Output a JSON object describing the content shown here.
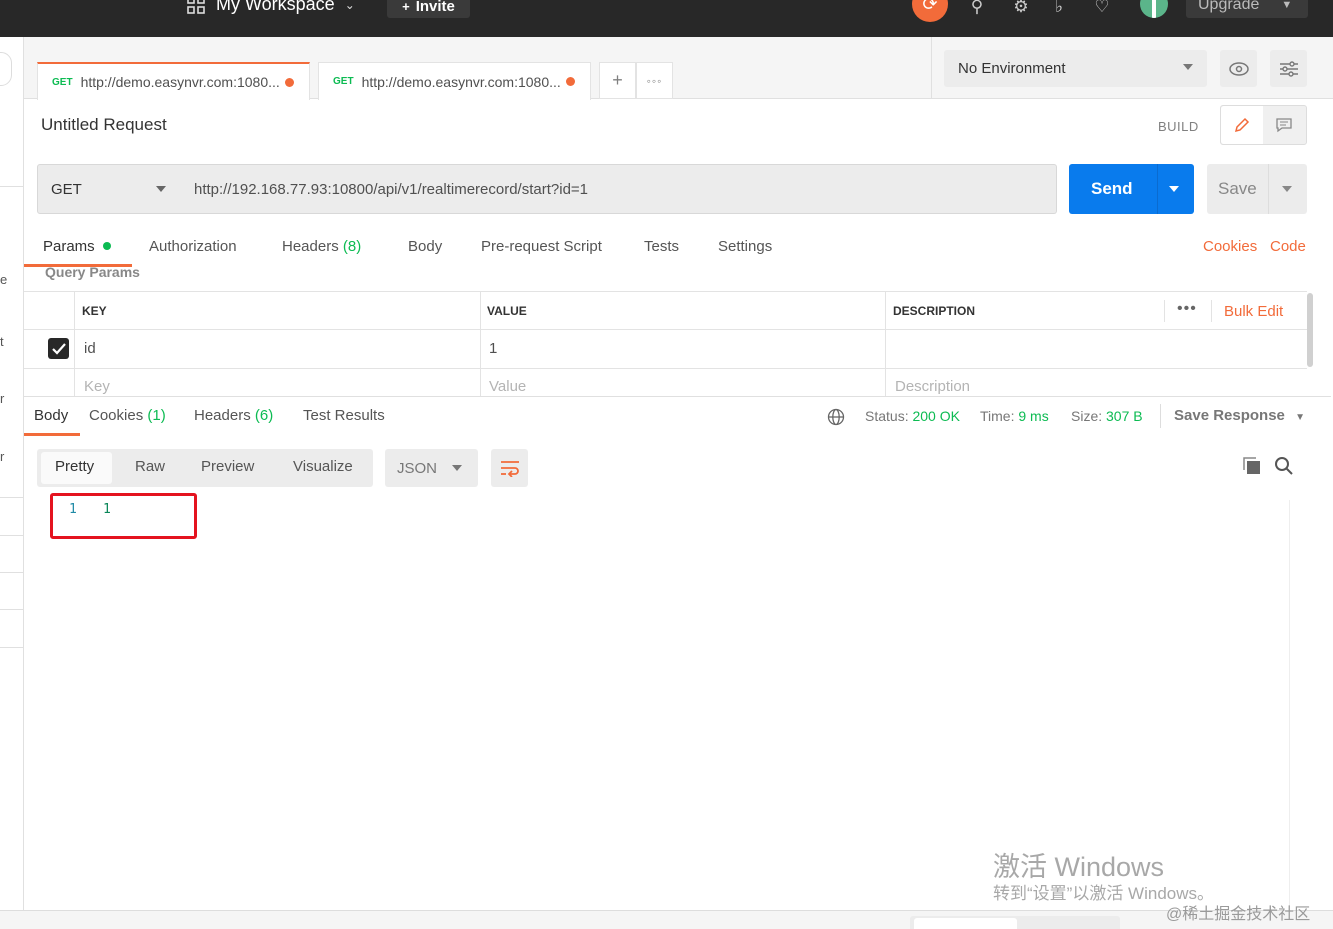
{
  "topbar": {
    "workspace_label": "My Workspace",
    "invite_label": "Invite",
    "upgrade_label": "Upgrade"
  },
  "tabs": [
    {
      "method": "GET",
      "url": "http://demo.easynvr.com:1080..."
    },
    {
      "method": "GET",
      "url": "http://demo.easynvr.com:1080..."
    }
  ],
  "environment": {
    "selected": "No Environment"
  },
  "request": {
    "title": "Untitled Request",
    "build_label": "BUILD",
    "method": "GET",
    "url": "http://192.168.77.93:10800/api/v1/realtimerecord/start?id=1",
    "send_label": "Send",
    "save_label": "Save"
  },
  "request_tabs": {
    "params": "Params",
    "authorization": "Authorization",
    "headers": "Headers",
    "headers_count": "(8)",
    "body": "Body",
    "pre_request": "Pre-request Script",
    "tests": "Tests",
    "settings": "Settings",
    "cookies": "Cookies",
    "code": "Code"
  },
  "query_params": {
    "section_title": "Query Params",
    "headers": {
      "key": "KEY",
      "value": "VALUE",
      "description": "DESCRIPTION"
    },
    "bulk_edit": "Bulk Edit",
    "rows": [
      {
        "key": "id",
        "value": "1",
        "description": ""
      }
    ],
    "placeholders": {
      "key": "Key",
      "value": "Value",
      "description": "Description"
    }
  },
  "response": {
    "tabs": {
      "body": "Body",
      "cookies": "Cookies",
      "cookies_count": "(1)",
      "headers": "Headers",
      "headers_count": "(6)",
      "test_results": "Test Results"
    },
    "status_label": "Status:",
    "status_value": "200 OK",
    "time_label": "Time:",
    "time_value": "9 ms",
    "size_label": "Size:",
    "size_value": "307 B",
    "save_response": "Save Response",
    "view_modes": [
      "Pretty",
      "Raw",
      "Preview",
      "Visualize"
    ],
    "format": "JSON",
    "code_lines": [
      {
        "line": "1",
        "text": "1"
      }
    ]
  },
  "left_edge_chars": [
    "e",
    "t",
    "r",
    "r"
  ],
  "watermark": {
    "title": "激活 Windows",
    "subtitle": "转到“设置”以激活 Windows。"
  },
  "credit": "@稀土掘金技术社区",
  "colors": {
    "accent": "#f26b3a",
    "send_blue": "#097bed",
    "success_green": "#0cbb52",
    "highlight_red": "#e4131f",
    "topbar": "#282828"
  }
}
